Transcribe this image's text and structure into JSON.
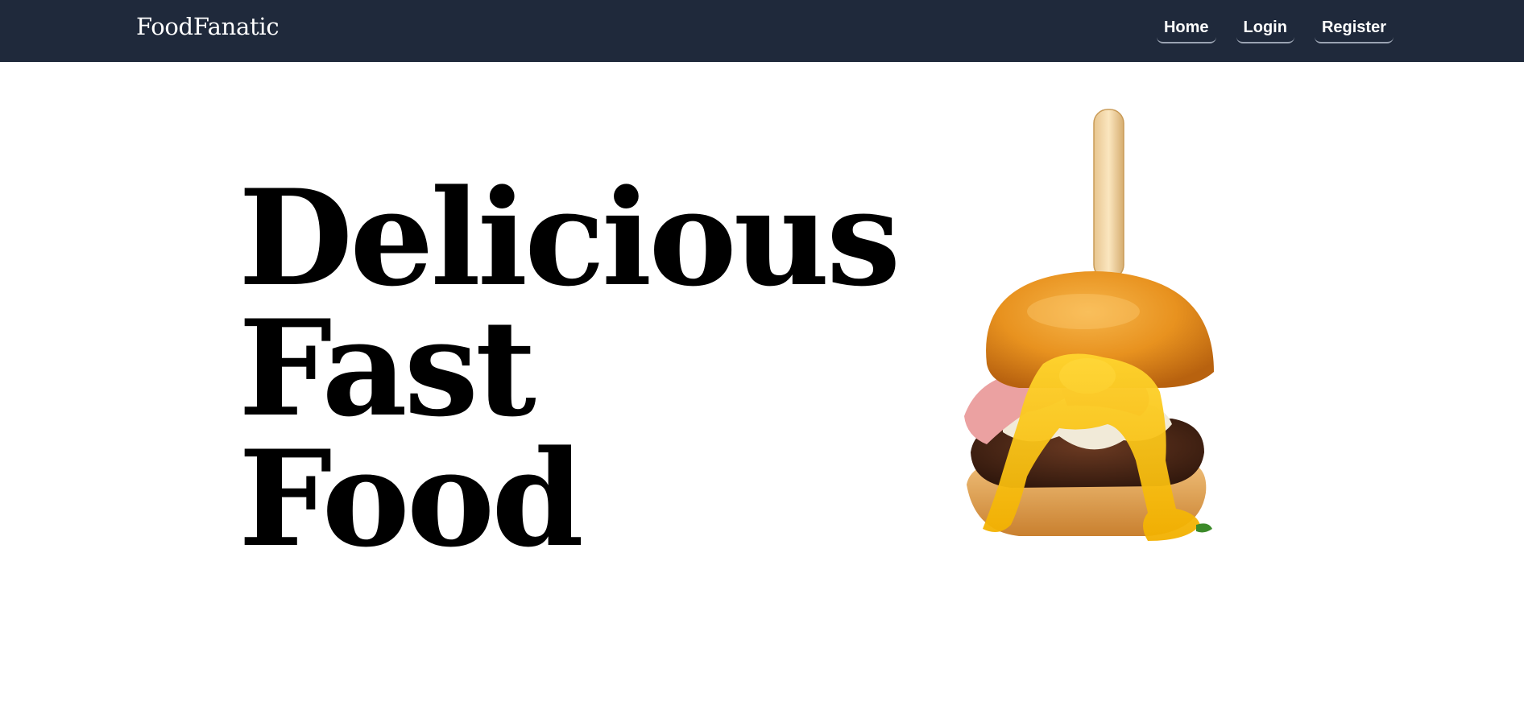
{
  "navbar": {
    "brand": "FoodFanatic",
    "links": [
      {
        "label": "Home"
      },
      {
        "label": "Login"
      },
      {
        "label": "Register"
      }
    ],
    "background": "#1f293b"
  },
  "hero": {
    "title_lines": [
      "Delicious",
      "Fast",
      "Food"
    ],
    "image": "burger-image"
  }
}
